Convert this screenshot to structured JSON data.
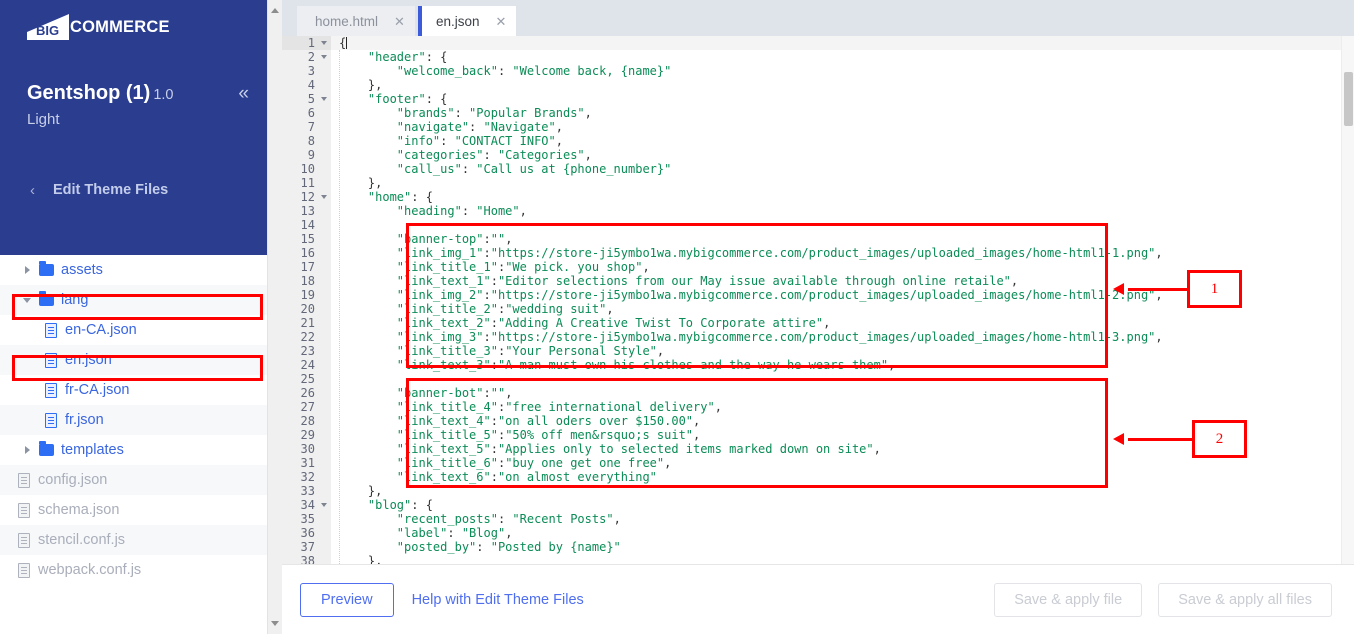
{
  "brand": {
    "logo_text": "COMMERCE",
    "logo_mark_text": "BIG",
    "accent_blue": "#2a3d8f",
    "link_blue": "#3a66e0",
    "annotation_red": "#ff0000"
  },
  "sidebar": {
    "theme_name": "Gentshop (1)",
    "theme_version": "1.0",
    "theme_variant": "Light",
    "collapse_icon": "double-chevron-left-icon",
    "back_icon": "chevron-left-icon",
    "section_label": "Edit Theme Files",
    "tree": [
      {
        "label": "assets",
        "type": "folder",
        "state": "collapsed",
        "depth": 0,
        "muted": false,
        "highlighted": false
      },
      {
        "label": "lang",
        "type": "folder",
        "state": "expanded",
        "depth": 0,
        "muted": false,
        "highlighted": true
      },
      {
        "label": "en-CA.json",
        "type": "file",
        "state": "",
        "depth": 1,
        "muted": false,
        "highlighted": false
      },
      {
        "label": "en.json",
        "type": "file",
        "state": "",
        "depth": 1,
        "muted": false,
        "highlighted": true
      },
      {
        "label": "fr-CA.json",
        "type": "file",
        "state": "",
        "depth": 1,
        "muted": false,
        "highlighted": false
      },
      {
        "label": "fr.json",
        "type": "file",
        "state": "",
        "depth": 1,
        "muted": false,
        "highlighted": false
      },
      {
        "label": "templates",
        "type": "folder",
        "state": "collapsed",
        "depth": 0,
        "muted": false,
        "highlighted": false
      },
      {
        "label": "config.json",
        "type": "file",
        "state": "",
        "depth": 0,
        "muted": true,
        "highlighted": false
      },
      {
        "label": "schema.json",
        "type": "file",
        "state": "",
        "depth": 0,
        "muted": true,
        "highlighted": false
      },
      {
        "label": "stencil.conf.js",
        "type": "file",
        "state": "",
        "depth": 0,
        "muted": true,
        "highlighted": false
      },
      {
        "label": "webpack.conf.js",
        "type": "file",
        "state": "",
        "depth": 0,
        "muted": true,
        "highlighted": false
      }
    ]
  },
  "tabs": [
    {
      "label": "home.html",
      "active": false,
      "close_icon": "close-icon"
    },
    {
      "label": "en.json",
      "active": true,
      "close_icon": "close-icon"
    }
  ],
  "editor": {
    "language": "json",
    "first_line_number": 1,
    "last_line_number": 38,
    "fold_lines": [
      1,
      2,
      5,
      12,
      34
    ],
    "lines": [
      {
        "n": 1,
        "text": "{"
      },
      {
        "n": 2,
        "text": "    \"header\": {"
      },
      {
        "n": 3,
        "text": "        \"welcome_back\": \"Welcome back, {name}\""
      },
      {
        "n": 4,
        "text": "    },"
      },
      {
        "n": 5,
        "text": "    \"footer\": {"
      },
      {
        "n": 6,
        "text": "        \"brands\": \"Popular Brands\","
      },
      {
        "n": 7,
        "text": "        \"navigate\": \"Navigate\","
      },
      {
        "n": 8,
        "text": "        \"info\": \"CONTACT INFO\","
      },
      {
        "n": 9,
        "text": "        \"categories\": \"Categories\","
      },
      {
        "n": 10,
        "text": "        \"call_us\": \"Call us at {phone_number}\""
      },
      {
        "n": 11,
        "text": "    },"
      },
      {
        "n": 12,
        "text": "    \"home\": {"
      },
      {
        "n": 13,
        "text": "        \"heading\": \"Home\","
      },
      {
        "n": 14,
        "text": ""
      },
      {
        "n": 15,
        "text": "        \"banner-top\":\"\","
      },
      {
        "n": 16,
        "text": "        \"link_img_1\":\"https://store-ji5ymbo1wa.mybigcommerce.com/product_images/uploaded_images/home-html1-1.png\","
      },
      {
        "n": 17,
        "text": "        \"link_title_1\":\"We pick. you shop\","
      },
      {
        "n": 18,
        "text": "        \"link_text_1\":\"Editor selections from our May issue available through online retaile\","
      },
      {
        "n": 19,
        "text": "        \"link_img_2\":\"https://store-ji5ymbo1wa.mybigcommerce.com/product_images/uploaded_images/home-html1-2.png\","
      },
      {
        "n": 20,
        "text": "        \"link_title_2\":\"wedding suit\","
      },
      {
        "n": 21,
        "text": "        \"link_text_2\":\"Adding A Creative Twist To Corporate attire\","
      },
      {
        "n": 22,
        "text": "        \"link_img_3\":\"https://store-ji5ymbo1wa.mybigcommerce.com/product_images/uploaded_images/home-html1-3.png\","
      },
      {
        "n": 23,
        "text": "        \"link_title_3\":\"Your Personal Style\","
      },
      {
        "n": 24,
        "text": "        \"link_text_3\":\"A man must own his clothes and the way he wears them\","
      },
      {
        "n": 25,
        "text": ""
      },
      {
        "n": 26,
        "text": "        \"banner-bot\":\"\","
      },
      {
        "n": 27,
        "text": "        \"link_title_4\":\"free international delivery\","
      },
      {
        "n": 28,
        "text": "        \"link_text_4\":\"on all oders over $150.00\","
      },
      {
        "n": 29,
        "text": "        \"link_title_5\":\"50% off men&rsquo;s suit\","
      },
      {
        "n": 30,
        "text": "        \"link_text_5\":\"Applies only to selected items marked down on site\","
      },
      {
        "n": 31,
        "text": "        \"link_title_6\":\"buy one get one free\","
      },
      {
        "n": 32,
        "text": "        \"link_text_6\":\"on almost everything\""
      },
      {
        "n": 33,
        "text": "    },"
      },
      {
        "n": 34,
        "text": "    \"blog\": {"
      },
      {
        "n": 35,
        "text": "        \"recent_posts\": \"Recent Posts\","
      },
      {
        "n": 36,
        "text": "        \"label\": \"Blog\","
      },
      {
        "n": 37,
        "text": "        \"posted_by\": \"Posted by {name}\""
      },
      {
        "n": 38,
        "text": "    },"
      }
    ]
  },
  "toolbar": {
    "preview_label": "Preview",
    "help_label": "Help with Edit Theme Files",
    "save_file_label": "Save & apply file",
    "save_all_label": "Save & apply all files"
  },
  "annotations": [
    {
      "id": "1",
      "label": "1",
      "target": "banner-top-block"
    },
    {
      "id": "2",
      "label": "2",
      "target": "banner-bot-block"
    }
  ]
}
